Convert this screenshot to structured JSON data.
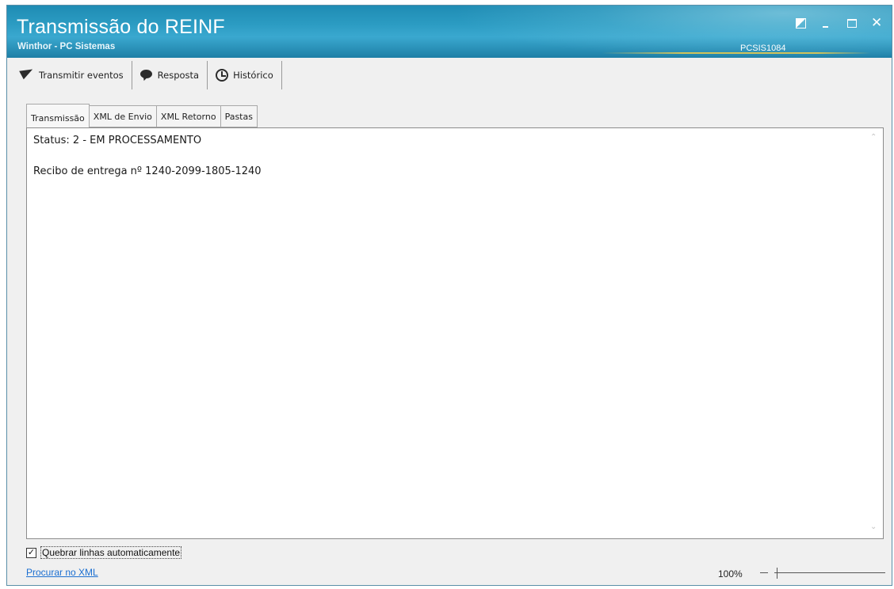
{
  "window": {
    "title": "Transmissão do REINF",
    "subtitle": "Winthor - PC Sistemas",
    "code": "PCSIS1084",
    "accent_color": "#2b9bc2"
  },
  "window_controls": {
    "restore_icon": "restore-icon",
    "minimize_icon": "minimize-icon",
    "maximize_icon": "maximize-icon",
    "close_icon": "close-icon",
    "close_glyph": "✕"
  },
  "main_tabs": [
    {
      "label": "Transmitir eventos",
      "icon": "paper-plane-icon"
    },
    {
      "label": "Resposta",
      "icon": "speech-bubble-icon",
      "active": true
    },
    {
      "label": "Histórico",
      "icon": "clock-icon"
    }
  ],
  "sub_tabs": [
    {
      "label": "Transmissão",
      "active": true
    },
    {
      "label": "XML de Envio"
    },
    {
      "label": "XML Retorno"
    },
    {
      "label": "Pastas"
    }
  ],
  "content": {
    "status_line": "Status: 2 - EM PROCESSAMENTO",
    "receipt_line": "Recibo de entrega nº 1240-2099-1805-1240"
  },
  "footer": {
    "wrap_checkbox_label": "Quebrar linhas automaticamente",
    "wrap_checked": true,
    "check_glyph": "✓",
    "search_link": "Procurar no XML",
    "zoom_label": "100%",
    "zoom_level_fraction": 0.0
  }
}
